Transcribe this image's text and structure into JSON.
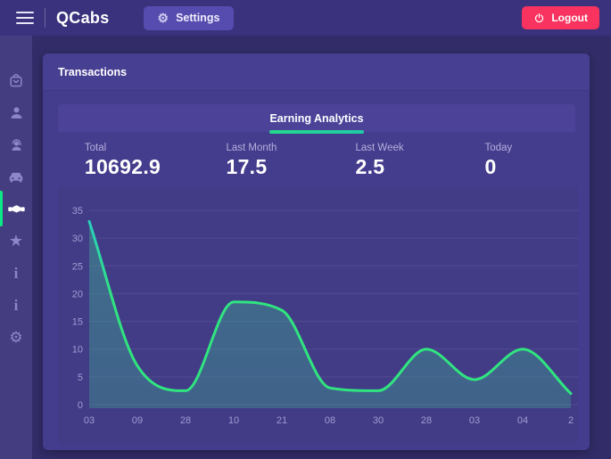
{
  "navbar": {
    "brand": "QCabs",
    "settings_label": "Settings",
    "logout_label": "Logout"
  },
  "sidebar": {
    "active_index": 4,
    "items": [
      {
        "icon": "shopping-bag-icon",
        "name": "orders"
      },
      {
        "icon": "user-icon",
        "name": "riders"
      },
      {
        "icon": "support-agent-icon",
        "name": "drivers"
      },
      {
        "icon": "car-icon",
        "name": "vehicles"
      },
      {
        "icon": "handshake-icon",
        "name": "transactions"
      },
      {
        "icon": "star-icon",
        "name": "ratings"
      },
      {
        "icon": "info-icon",
        "name": "info-1"
      },
      {
        "icon": "info-icon",
        "name": "info-2"
      },
      {
        "icon": "gear-icon",
        "name": "settings"
      }
    ]
  },
  "main": {
    "title": "Transactions",
    "tab": {
      "label": "Earning Analytics",
      "underline_color": "#24d98b"
    },
    "stats": [
      {
        "label": "Total",
        "value": "10692.9"
      },
      {
        "label": "Last Month",
        "value": "17.5"
      },
      {
        "label": "Last Week",
        "value": "2.5"
      },
      {
        "label": "Today",
        "value": "0"
      }
    ]
  },
  "chart_data": {
    "type": "area",
    "title": "Earning Analytics",
    "x_labels": [
      "03",
      "09",
      "28",
      "10",
      "21",
      "08",
      "30",
      "28",
      "03",
      "04",
      "2"
    ],
    "values": [
      33,
      7,
      2.5,
      18.5,
      17,
      3,
      2.5,
      10,
      4.5,
      10,
      2
    ],
    "ylim": [
      0,
      35
    ],
    "ytick_step": 5,
    "grid": "horizontal",
    "legend": "none",
    "line_gradient": [
      "#27cdc4",
      "#30e57f"
    ],
    "fill_color_rgb": "61,162,146",
    "fill_opacity_top": 0.5,
    "fill_opacity_bottom": 0.38,
    "tick_color": "#a29cd4",
    "grid_color": "rgba(255,255,255,0.09)"
  }
}
